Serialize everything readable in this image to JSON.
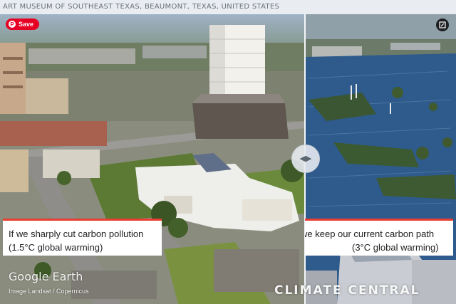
{
  "caption": "ART MUSEUM OF SOUTHEAST TEXAS, BEAUMONT, TEXAS, UNITED STATES",
  "save_button": {
    "label": "Save",
    "icon": "pinterest-icon"
  },
  "expand_button": {
    "icon": "expand-icon"
  },
  "slider": {
    "icon": "left-right-arrows-icon",
    "position": 0.67
  },
  "scenario_left": {
    "line1": "If we sharply cut carbon pollution",
    "line2": "(1.5°C global warming)"
  },
  "scenario_right": {
    "line1": "we keep our current carbon path",
    "line2": "(3°C global warming)"
  },
  "map_logo": "Google Earth",
  "map_credit": "Image Landsat / Copernicus",
  "brand": "CLIMATE CENTRAL",
  "colors": {
    "accent": "#e83d30",
    "save": "#e60023",
    "flood": "#2f5f8e"
  }
}
